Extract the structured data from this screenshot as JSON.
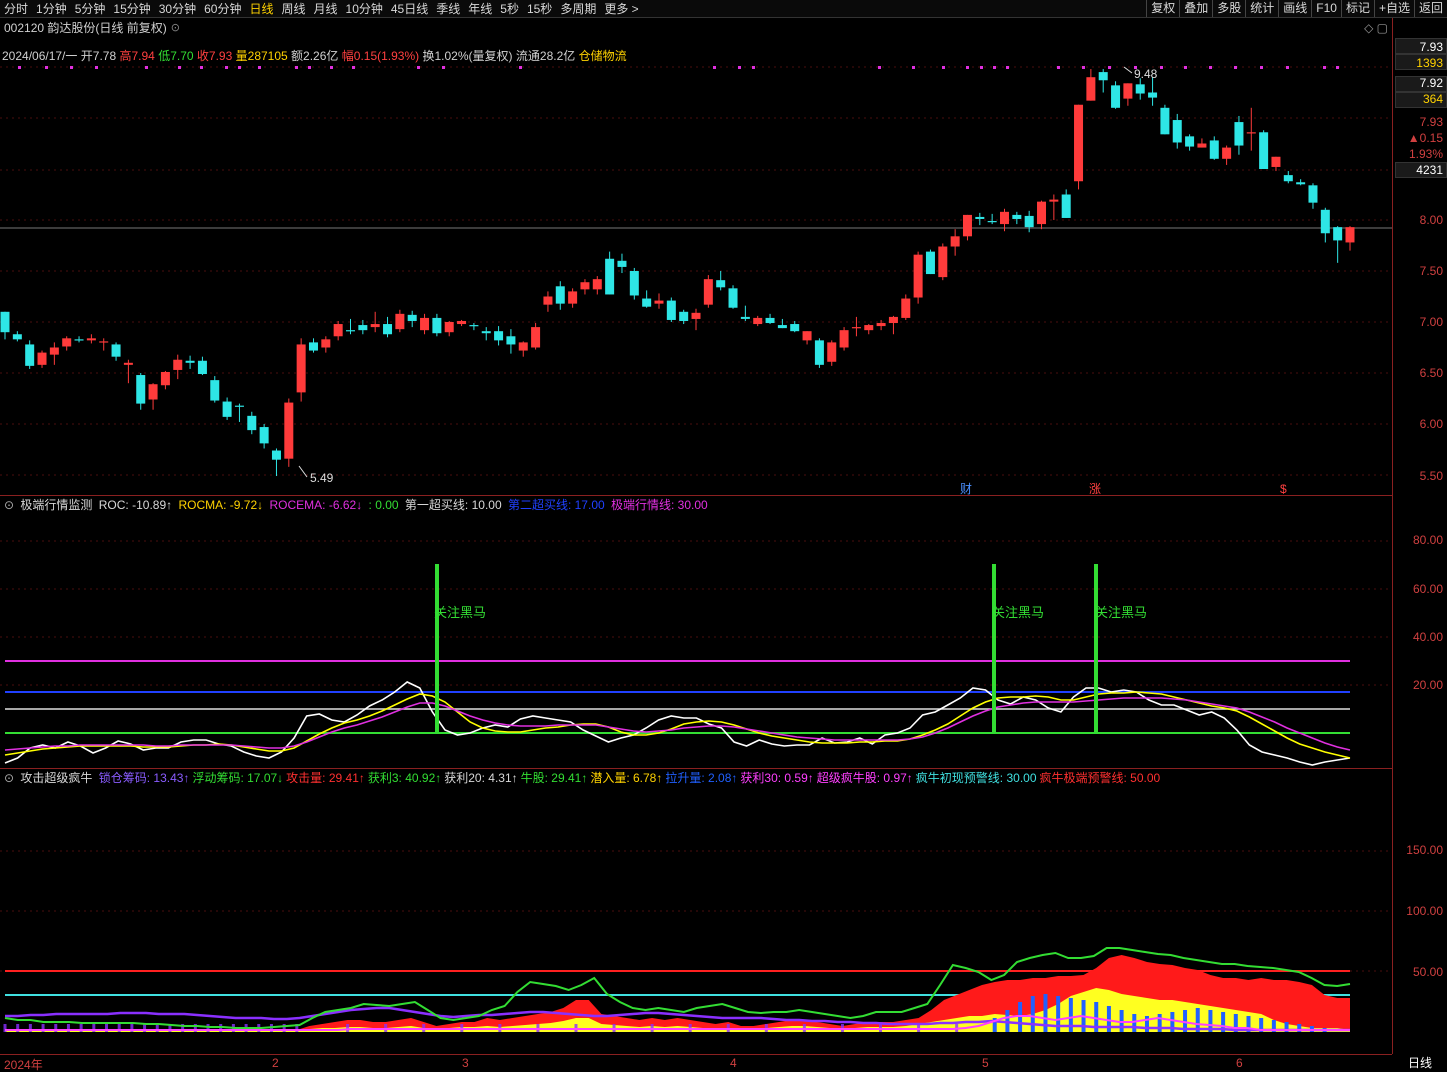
{
  "toolbar": {
    "tabs": [
      "分时",
      "1分钟",
      "5分钟",
      "15分钟",
      "30分钟",
      "60分钟",
      "日线",
      "周线",
      "月线",
      "10分钟",
      "45日线",
      "季线",
      "年线",
      "5秒",
      "15秒",
      "多周期",
      "更多 >"
    ],
    "active": "日线",
    "right": [
      "复权",
      "叠加",
      "多股",
      "统计",
      "画线",
      "F10",
      "标记",
      "+自选",
      "返回"
    ]
  },
  "stock": {
    "title": "002120 韵达股份(日线 前复权)",
    "gear": "⊙",
    "winctl": "◇ ▢"
  },
  "info": {
    "date": "2024/06/17/一",
    "open_label": "开",
    "open": "7.78",
    "high_label": "高",
    "high": "7.94",
    "low_label": "低",
    "low": "7.70",
    "close_label": "收",
    "close": "7.93",
    "vol_label": "量",
    "vol": "287105",
    "amt_label": "额",
    "amt": "2.26亿",
    "chg_label": "幅",
    "chg": "0.15(1.93%)",
    "turn_label": "换",
    "turn": "1.02%(量复权)",
    "float_label": "流通",
    "float": "28.2亿",
    "sector": "仓储物流"
  },
  "price_axis": {
    "ticks": [
      "8.00",
      "7.50",
      "7.00",
      "6.50",
      "6.00",
      "5.50"
    ],
    "box": [
      "7.93",
      "1393",
      "7.92",
      "364",
      "7.93",
      "▲0.15",
      "1.93%",
      "4231"
    ]
  },
  "price_marks": {
    "high": "9.48",
    "low": "5.49"
  },
  "events": [
    "财",
    "涨",
    "$"
  ],
  "ind1": {
    "name": "极端行情监测",
    "roc": "ROC: -10.89↑",
    "rocma": "ROCMA: -9.72↓",
    "rocema": "ROCEMA: -6.62↓",
    "zero": ": 0.00",
    "line1": "第一超买线: 10.00",
    "line2": "第二超买线: 17.00",
    "line3": "极端行情线: 30.00",
    "ticks": [
      "80.00",
      "60.00",
      "40.00",
      "20.00"
    ],
    "signal": "关注黑马"
  },
  "ind2": {
    "name": "攻击超级疯牛",
    "items": [
      {
        "t": "锁仓筹码: 13.43↑",
        "c": "#8a5cff"
      },
      {
        "t": "浮动筹码: 17.07↓",
        "c": "#33dd33"
      },
      {
        "t": "攻击量: 29.41↑",
        "c": "#ff3030"
      },
      {
        "t": "获利3: 40.92↑",
        "c": "#33dd33"
      },
      {
        "t": "获利20: 4.31↑",
        "c": "#d8d8d8"
      },
      {
        "t": "牛股: 29.41↑",
        "c": "#33dd33"
      },
      {
        "t": "潜入量: 6.78↑",
        "c": "#ffd200"
      },
      {
        "t": "拉升量: 2.08↑",
        "c": "#2060ff"
      },
      {
        "t": "获利30: 0.59↑",
        "c": "#ff40ff"
      },
      {
        "t": "超级疯牛股: 0.97↑",
        "c": "#ff40ff"
      },
      {
        "t": "疯牛初现预警线: 30.00",
        "c": "#40e0e0"
      },
      {
        "t": "疯牛极端预警线: 50.00",
        "c": "#ff3030"
      }
    ],
    "ticks": [
      "150.00",
      "100.00",
      "50.00"
    ]
  },
  "xaxis": {
    "labels": [
      "2024年",
      "2",
      "3",
      "4",
      "5",
      "6"
    ],
    "period": "日线"
  },
  "colors": {
    "up": "#ff3b3b",
    "down": "#2ee6e6",
    "grid": "#5a1010"
  },
  "chart_data": {
    "type": "candlestick",
    "ohlc": [
      [
        7.1,
        7.07,
        6.83,
        6.9
      ],
      [
        6.88,
        6.91,
        6.81,
        6.83
      ],
      [
        6.78,
        6.82,
        6.54,
        6.57
      ],
      [
        6.58,
        6.72,
        6.55,
        6.7
      ],
      [
        6.68,
        6.8,
        6.58,
        6.75
      ],
      [
        6.76,
        6.86,
        6.72,
        6.84
      ],
      [
        6.83,
        6.86,
        6.8,
        6.82
      ],
      [
        6.82,
        6.88,
        6.79,
        6.84
      ],
      [
        6.8,
        6.84,
        6.72,
        6.81
      ],
      [
        6.78,
        6.8,
        6.62,
        6.66
      ],
      [
        6.58,
        6.63,
        6.4,
        6.6
      ],
      [
        6.48,
        6.5,
        6.14,
        6.2
      ],
      [
        6.24,
        6.4,
        6.14,
        6.39
      ],
      [
        6.38,
        6.52,
        6.34,
        6.51
      ],
      [
        6.53,
        6.68,
        6.44,
        6.63
      ],
      [
        6.62,
        6.67,
        6.54,
        6.6
      ],
      [
        6.62,
        6.66,
        6.48,
        6.49
      ],
      [
        6.43,
        6.47,
        6.21,
        6.23
      ],
      [
        6.22,
        6.26,
        6.04,
        6.07
      ],
      [
        6.18,
        6.2,
        6.02,
        6.17
      ],
      [
        6.08,
        6.12,
        5.9,
        5.94
      ],
      [
        5.97,
        6.0,
        5.76,
        5.81
      ],
      [
        5.74,
        5.76,
        5.49,
        5.65
      ],
      [
        5.66,
        6.25,
        5.58,
        6.21
      ],
      [
        6.31,
        6.84,
        6.22,
        6.78
      ],
      [
        6.8,
        6.84,
        6.7,
        6.72
      ],
      [
        6.75,
        6.86,
        6.7,
        6.83
      ],
      [
        6.86,
        7.01,
        6.82,
        6.98
      ],
      [
        6.92,
        7.03,
        6.88,
        6.91
      ],
      [
        6.97,
        7.02,
        6.88,
        6.92
      ],
      [
        6.95,
        7.1,
        6.9,
        6.98
      ],
      [
        6.98,
        7.05,
        6.85,
        6.88
      ],
      [
        6.93,
        7.12,
        6.9,
        7.08
      ],
      [
        7.07,
        7.11,
        6.95,
        7.01
      ],
      [
        6.92,
        7.08,
        6.88,
        7.04
      ],
      [
        7.04,
        7.08,
        6.86,
        6.89
      ],
      [
        6.9,
        7.01,
        6.86,
        7.0
      ],
      [
        6.98,
        7.02,
        6.96,
        7.01
      ],
      [
        6.97,
        6.99,
        6.92,
        6.96
      ],
      [
        6.91,
        6.95,
        6.82,
        6.89
      ],
      [
        6.91,
        6.96,
        6.77,
        6.82
      ],
      [
        6.86,
        6.93,
        6.69,
        6.78
      ],
      [
        6.72,
        6.81,
        6.66,
        6.8
      ],
      [
        6.75,
        6.99,
        6.73,
        6.95
      ],
      [
        7.17,
        7.3,
        7.1,
        7.25
      ],
      [
        7.35,
        7.4,
        7.12,
        7.18
      ],
      [
        7.18,
        7.33,
        7.14,
        7.3
      ],
      [
        7.32,
        7.42,
        7.27,
        7.39
      ],
      [
        7.32,
        7.45,
        7.27,
        7.42
      ],
      [
        7.62,
        7.69,
        7.28,
        7.27
      ],
      [
        7.6,
        7.67,
        7.48,
        7.54
      ],
      [
        7.5,
        7.53,
        7.22,
        7.26
      ],
      [
        7.23,
        7.31,
        7.14,
        7.15
      ],
      [
        7.18,
        7.28,
        7.13,
        7.21
      ],
      [
        7.21,
        7.24,
        7.0,
        7.02
      ],
      [
        7.1,
        7.12,
        6.98,
        7.01
      ],
      [
        7.03,
        7.13,
        6.92,
        7.09
      ],
      [
        7.17,
        7.46,
        7.14,
        7.42
      ],
      [
        7.41,
        7.5,
        7.31,
        7.34
      ],
      [
        7.33,
        7.36,
        7.13,
        7.14
      ],
      [
        7.05,
        7.16,
        7.01,
        7.03
      ],
      [
        6.98,
        7.06,
        6.96,
        7.04
      ],
      [
        7.04,
        7.08,
        6.98,
        6.99
      ],
      [
        6.97,
        7.03,
        6.95,
        6.94
      ],
      [
        6.98,
        7.01,
        6.9,
        6.91
      ],
      [
        6.82,
        6.89,
        6.78,
        6.91
      ],
      [
        6.82,
        6.84,
        6.55,
        6.58
      ],
      [
        6.61,
        6.82,
        6.57,
        6.8
      ],
      [
        6.75,
        6.95,
        6.72,
        6.92
      ],
      [
        6.94,
        7.05,
        6.86,
        6.95
      ],
      [
        6.92,
        6.98,
        6.88,
        6.97
      ],
      [
        6.96,
        7.02,
        6.92,
        6.99
      ],
      [
        6.99,
        7.06,
        6.88,
        7.05
      ],
      [
        7.04,
        7.27,
        7.02,
        7.23
      ],
      [
        7.24,
        7.69,
        7.18,
        7.66
      ],
      [
        7.69,
        7.71,
        7.48,
        7.47
      ],
      [
        7.44,
        7.77,
        7.41,
        7.74
      ],
      [
        7.74,
        7.91,
        7.65,
        7.84
      ],
      [
        7.84,
        8.0,
        7.8,
        8.05
      ],
      [
        8.03,
        8.07,
        7.95,
        8.01
      ],
      [
        7.99,
        8.06,
        7.96,
        7.98
      ],
      [
        7.96,
        8.11,
        7.89,
        8.08
      ],
      [
        8.05,
        8.08,
        7.96,
        8.01
      ],
      [
        8.04,
        8.09,
        7.88,
        7.93
      ],
      [
        7.96,
        8.19,
        7.91,
        8.18
      ],
      [
        8.18,
        8.25,
        8.0,
        8.2
      ],
      [
        8.25,
        8.3,
        8.08,
        8.02
      ],
      [
        8.38,
        9.12,
        8.3,
        9.13
      ],
      [
        9.17,
        9.48,
        9.18,
        9.4
      ],
      [
        9.45,
        9.48,
        9.25,
        9.37
      ],
      [
        9.32,
        9.36,
        9.09,
        9.1
      ],
      [
        9.19,
        9.32,
        9.12,
        9.34
      ],
      [
        9.33,
        9.39,
        9.18,
        9.24
      ],
      [
        9.25,
        9.4,
        9.12,
        9.2
      ],
      [
        9.1,
        9.13,
        8.9,
        8.84
      ],
      [
        8.98,
        9.04,
        8.7,
        8.76
      ],
      [
        8.82,
        8.84,
        8.68,
        8.72
      ],
      [
        8.71,
        8.8,
        8.71,
        8.75
      ],
      [
        8.78,
        8.82,
        8.59,
        8.6
      ],
      [
        8.6,
        8.73,
        8.54,
        8.71
      ],
      [
        8.96,
        9.02,
        8.64,
        8.73
      ],
      [
        8.86,
        9.1,
        8.68,
        8.86
      ],
      [
        8.86,
        8.88,
        8.56,
        8.5
      ],
      [
        8.52,
        8.61,
        8.48,
        8.62
      ],
      [
        8.44,
        8.48,
        8.36,
        8.38
      ],
      [
        8.37,
        8.4,
        8.34,
        8.35
      ],
      [
        8.34,
        8.36,
        8.11,
        8.17
      ],
      [
        8.1,
        8.12,
        7.78,
        7.87
      ],
      [
        7.93,
        7.94,
        7.58,
        7.8
      ],
      [
        7.78,
        7.94,
        7.7,
        7.93
      ]
    ]
  }
}
